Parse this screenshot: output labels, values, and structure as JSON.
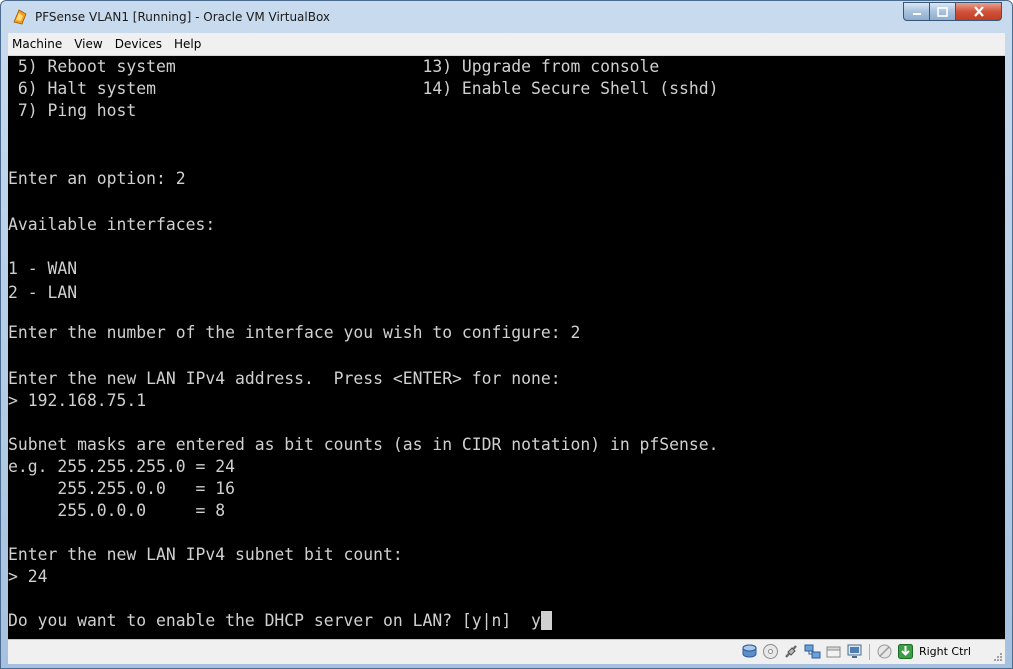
{
  "window": {
    "title": "PFSense VLAN1 [Running] - Oracle VM VirtualBox",
    "minimize_label": "–",
    "maximize_label": "□",
    "close_label": "✕"
  },
  "menubar": {
    "items": [
      "Machine",
      "View",
      "Devices",
      "Help"
    ]
  },
  "terminal": {
    "lines": [
      " 5) Reboot system                         13) Upgrade from console",
      " 6) Halt system                           14) Enable Secure Shell (sshd)",
      " 7) Ping host",
      "",
      "Enter an option: 2",
      "",
      "Available interfaces:",
      "",
      "1 - WAN",
      "2 - LAN",
      "",
      "Enter the number of the interface you wish to configure: 2",
      "",
      "Enter the new LAN IPv4 address.  Press <ENTER> for none:",
      "> 192.168.75.1",
      "",
      "Subnet masks are entered as bit counts (as in CIDR notation) in pfSense.",
      "e.g. 255.255.255.0 = 24",
      "     255.255.0.0   = 16",
      "     255.0.0.0     = 8",
      "",
      "Enter the new LAN IPv4 subnet bit count:",
      "> 24",
      "",
      "Do you want to enable the DHCP server on LAN? [y|n]  y"
    ]
  },
  "statusbar": {
    "icons": [
      "hard-disk-icon",
      "optical-drive-icon",
      "usb-icon",
      "network-icon",
      "shared-folders-icon",
      "display-icon",
      "recording-icon",
      "mouse-integration-icon"
    ],
    "host_key": "Right Ctrl"
  },
  "colors": {
    "terminal_bg": "#000000",
    "terminal_fg": "#d0d0d0",
    "chrome": "#b3cbe6",
    "close_button": "#c23c22"
  }
}
